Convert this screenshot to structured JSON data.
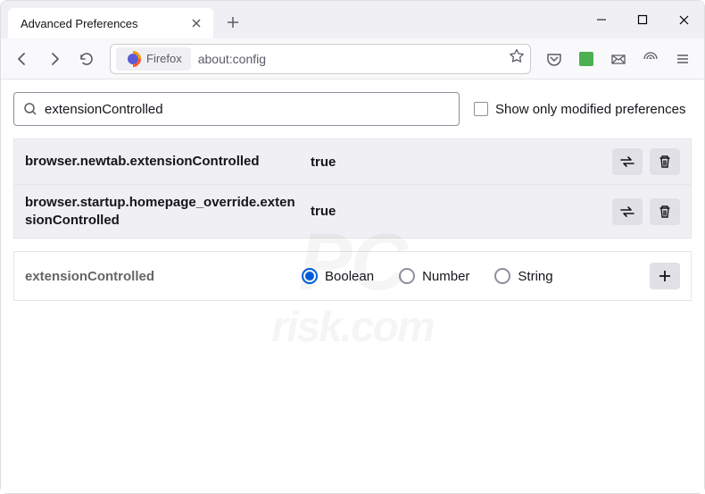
{
  "window": {
    "tab_title": "Advanced Preferences"
  },
  "urlbar": {
    "identity_label": "Firefox",
    "url": "about:config"
  },
  "aboutconfig": {
    "search_value": "extensionControlled",
    "show_only_modified_label": "Show only modified preferences",
    "prefs": [
      {
        "name": "browser.newtab.extensionControlled",
        "value": "true"
      },
      {
        "name": "browser.startup.homepage_override.extensionControlled",
        "value": "true"
      }
    ],
    "new_pref_name": "extensionControlled",
    "type_options": {
      "boolean": "Boolean",
      "number": "Number",
      "string": "String"
    }
  }
}
